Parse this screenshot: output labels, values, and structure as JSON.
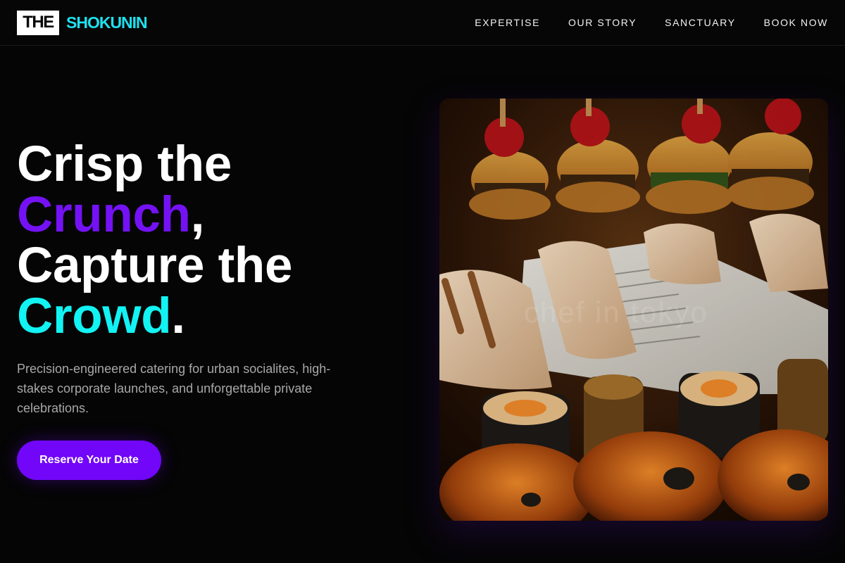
{
  "brand": {
    "box_text": "THE",
    "name": "SHOKUNIN"
  },
  "nav": {
    "items": [
      {
        "label": "EXPERTISE"
      },
      {
        "label": "OUR STORY"
      },
      {
        "label": "SANCTUARY"
      },
      {
        "label": "BOOK NOW"
      }
    ]
  },
  "hero": {
    "line1": "Crisp the",
    "line2_accent": "Crunch",
    "line2_punct": ",",
    "line3": "Capture the",
    "line4_accent": "Crowd",
    "line4_punct": ".",
    "subtitle": "Precision-engineered catering for urban socialites, high-stakes corporate launches, and unforgettable private celebrations.",
    "cta_label": "Reserve Your Date"
  },
  "image": {
    "alt": "Catering platter with sliders, wraps in newspaper, and sushi rolls",
    "watermark": "chef in tokyo"
  },
  "colors": {
    "background": "#050505",
    "accent_purple": "#7412f5",
    "accent_cyan": "#12f3f3",
    "cta": "#7106f8",
    "logo_cyan": "#1fe0ee"
  },
  "icons": {
    "logo": "logo-mark"
  }
}
